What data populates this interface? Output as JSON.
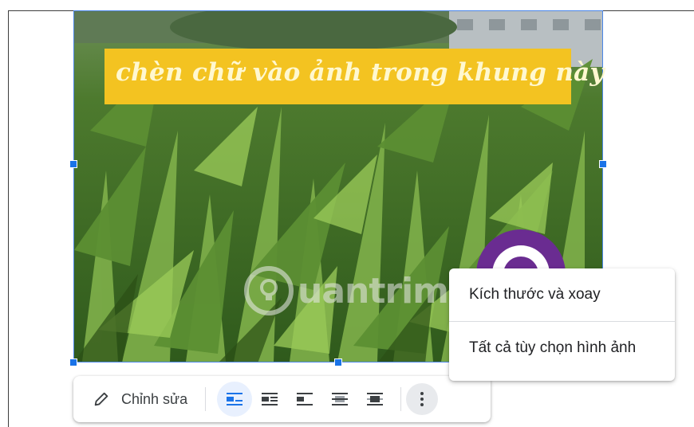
{
  "image": {
    "caption": "chèn chữ vào ảnh trong khung này",
    "watermark": "uantrimang",
    "colors": {
      "caption_bg": "#f3c321",
      "caption_text": "#fff8d0",
      "selection": "#1a73e8",
      "grass_dark": "#2f5a1c",
      "grass_light": "#7fb04a",
      "logo_purple": "#6a2c91"
    }
  },
  "toolbar": {
    "edit_label": "Chỉnh sửa",
    "edit_icon": "pencil-icon",
    "wrap_options": [
      {
        "name": "inline",
        "icon": "wrap-inline-icon",
        "active": true
      },
      {
        "name": "wrap-text",
        "icon": "wrap-text-icon",
        "active": false
      },
      {
        "name": "break-text",
        "icon": "break-text-icon",
        "active": false
      },
      {
        "name": "behind-text",
        "icon": "behind-text-icon",
        "active": false
      },
      {
        "name": "in-front-of-text",
        "icon": "in-front-of-text-icon",
        "active": false
      }
    ],
    "more_icon": "more-vert-icon"
  },
  "menu": {
    "items": [
      {
        "label": "Kích thước và xoay"
      },
      {
        "label": "Tất cả tùy chọn hình ảnh"
      }
    ]
  }
}
